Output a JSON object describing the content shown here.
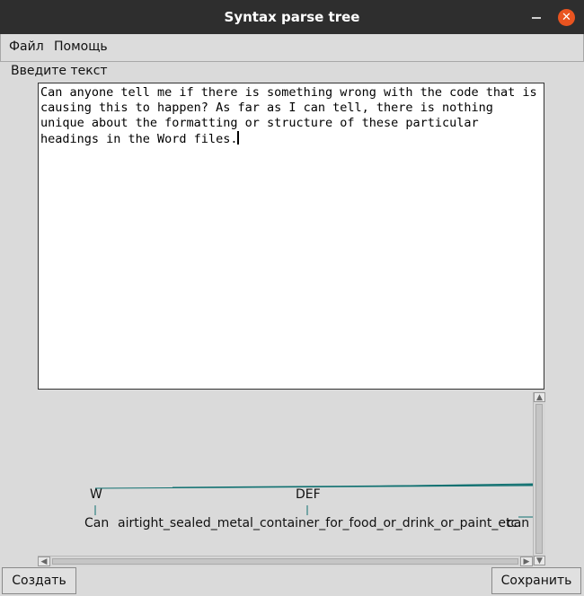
{
  "window": {
    "title": "Syntax parse tree",
    "close_glyph": "✕"
  },
  "menu": {
    "file": "Файл",
    "help": "Помощь"
  },
  "input": {
    "label": "Введите текст",
    "value": "Can anyone tell me if there is something wrong with the code that is causing this to happen? As far as I can tell, there is nothing unique about the formatting or structure of these particular headings in the Word files."
  },
  "tree": {
    "tags": [
      "W",
      "DEF"
    ],
    "words": [
      "Can",
      "airtight_sealed_metal_container_for_food_or_drink_or_paint_etc.",
      "can"
    ],
    "line_color": "#0f7070"
  },
  "scrollbars": {
    "up": "▲",
    "down": "▼",
    "left": "◀",
    "right": "▶"
  },
  "buttons": {
    "create": "Создать",
    "save": "Сохранить"
  }
}
